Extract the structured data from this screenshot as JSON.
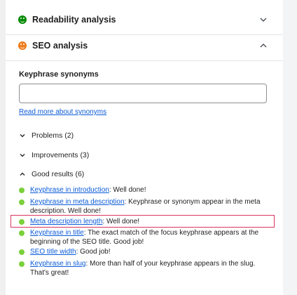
{
  "readability": {
    "title": "Readability analysis"
  },
  "seo": {
    "title": "SEO analysis"
  },
  "synonyms": {
    "label": "Keyphrase synonyms",
    "value": "",
    "read_more": "Read more about synonyms"
  },
  "groups": {
    "problems": "Problems (2)",
    "improvements": "Improvements (3)",
    "good": "Good results (6)"
  },
  "results": [
    {
      "link": "Keyphrase in introduction",
      "text": ": Well done!"
    },
    {
      "link": "Keyphrase in meta description",
      "text": ": Keyphrase or synonym appear in the meta description. Well done!"
    },
    {
      "link": "Meta description length",
      "text": ": Well done!"
    },
    {
      "link": "Keyphrase in title",
      "text": ": The exact match of the focus keyphrase appears at the beginning of the SEO title. Good job!"
    },
    {
      "link": "SEO title width",
      "text": ": Good job!"
    },
    {
      "link": "Keyphrase in slug",
      "text": ": More than half of your keyphrase appears in the slug. That's great!"
    }
  ],
  "colors": {
    "good_dot": "#7ad03a",
    "highlight": "#d7375f",
    "link": "#0b5bd8"
  }
}
